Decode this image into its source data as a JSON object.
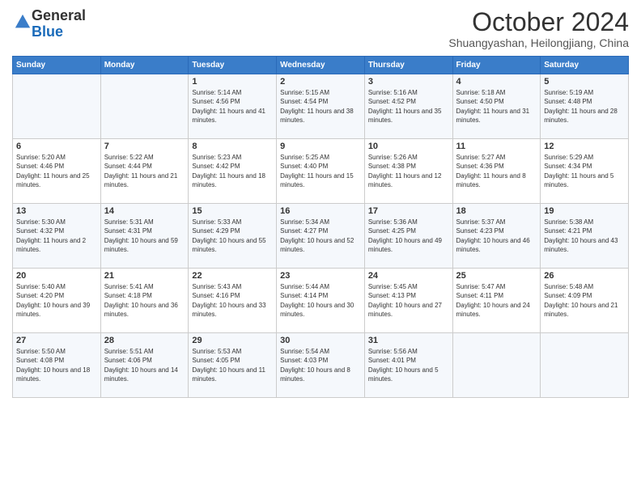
{
  "header": {
    "logo": {
      "line1": "General",
      "line2": "Blue"
    },
    "title": "October 2024",
    "location": "Shuangyashan, Heilongjiang, China"
  },
  "weekdays": [
    "Sunday",
    "Monday",
    "Tuesday",
    "Wednesday",
    "Thursday",
    "Friday",
    "Saturday"
  ],
  "weeks": [
    [
      {
        "day": null,
        "info": null
      },
      {
        "day": null,
        "info": null
      },
      {
        "day": "1",
        "info": "Sunrise: 5:14 AM\nSunset: 4:56 PM\nDaylight: 11 hours and 41 minutes."
      },
      {
        "day": "2",
        "info": "Sunrise: 5:15 AM\nSunset: 4:54 PM\nDaylight: 11 hours and 38 minutes."
      },
      {
        "day": "3",
        "info": "Sunrise: 5:16 AM\nSunset: 4:52 PM\nDaylight: 11 hours and 35 minutes."
      },
      {
        "day": "4",
        "info": "Sunrise: 5:18 AM\nSunset: 4:50 PM\nDaylight: 11 hours and 31 minutes."
      },
      {
        "day": "5",
        "info": "Sunrise: 5:19 AM\nSunset: 4:48 PM\nDaylight: 11 hours and 28 minutes."
      }
    ],
    [
      {
        "day": "6",
        "info": "Sunrise: 5:20 AM\nSunset: 4:46 PM\nDaylight: 11 hours and 25 minutes."
      },
      {
        "day": "7",
        "info": "Sunrise: 5:22 AM\nSunset: 4:44 PM\nDaylight: 11 hours and 21 minutes."
      },
      {
        "day": "8",
        "info": "Sunrise: 5:23 AM\nSunset: 4:42 PM\nDaylight: 11 hours and 18 minutes."
      },
      {
        "day": "9",
        "info": "Sunrise: 5:25 AM\nSunset: 4:40 PM\nDaylight: 11 hours and 15 minutes."
      },
      {
        "day": "10",
        "info": "Sunrise: 5:26 AM\nSunset: 4:38 PM\nDaylight: 11 hours and 12 minutes."
      },
      {
        "day": "11",
        "info": "Sunrise: 5:27 AM\nSunset: 4:36 PM\nDaylight: 11 hours and 8 minutes."
      },
      {
        "day": "12",
        "info": "Sunrise: 5:29 AM\nSunset: 4:34 PM\nDaylight: 11 hours and 5 minutes."
      }
    ],
    [
      {
        "day": "13",
        "info": "Sunrise: 5:30 AM\nSunset: 4:32 PM\nDaylight: 11 hours and 2 minutes."
      },
      {
        "day": "14",
        "info": "Sunrise: 5:31 AM\nSunset: 4:31 PM\nDaylight: 10 hours and 59 minutes."
      },
      {
        "day": "15",
        "info": "Sunrise: 5:33 AM\nSunset: 4:29 PM\nDaylight: 10 hours and 55 minutes."
      },
      {
        "day": "16",
        "info": "Sunrise: 5:34 AM\nSunset: 4:27 PM\nDaylight: 10 hours and 52 minutes."
      },
      {
        "day": "17",
        "info": "Sunrise: 5:36 AM\nSunset: 4:25 PM\nDaylight: 10 hours and 49 minutes."
      },
      {
        "day": "18",
        "info": "Sunrise: 5:37 AM\nSunset: 4:23 PM\nDaylight: 10 hours and 46 minutes."
      },
      {
        "day": "19",
        "info": "Sunrise: 5:38 AM\nSunset: 4:21 PM\nDaylight: 10 hours and 43 minutes."
      }
    ],
    [
      {
        "day": "20",
        "info": "Sunrise: 5:40 AM\nSunset: 4:20 PM\nDaylight: 10 hours and 39 minutes."
      },
      {
        "day": "21",
        "info": "Sunrise: 5:41 AM\nSunset: 4:18 PM\nDaylight: 10 hours and 36 minutes."
      },
      {
        "day": "22",
        "info": "Sunrise: 5:43 AM\nSunset: 4:16 PM\nDaylight: 10 hours and 33 minutes."
      },
      {
        "day": "23",
        "info": "Sunrise: 5:44 AM\nSunset: 4:14 PM\nDaylight: 10 hours and 30 minutes."
      },
      {
        "day": "24",
        "info": "Sunrise: 5:45 AM\nSunset: 4:13 PM\nDaylight: 10 hours and 27 minutes."
      },
      {
        "day": "25",
        "info": "Sunrise: 5:47 AM\nSunset: 4:11 PM\nDaylight: 10 hours and 24 minutes."
      },
      {
        "day": "26",
        "info": "Sunrise: 5:48 AM\nSunset: 4:09 PM\nDaylight: 10 hours and 21 minutes."
      }
    ],
    [
      {
        "day": "27",
        "info": "Sunrise: 5:50 AM\nSunset: 4:08 PM\nDaylight: 10 hours and 18 minutes."
      },
      {
        "day": "28",
        "info": "Sunrise: 5:51 AM\nSunset: 4:06 PM\nDaylight: 10 hours and 14 minutes."
      },
      {
        "day": "29",
        "info": "Sunrise: 5:53 AM\nSunset: 4:05 PM\nDaylight: 10 hours and 11 minutes."
      },
      {
        "day": "30",
        "info": "Sunrise: 5:54 AM\nSunset: 4:03 PM\nDaylight: 10 hours and 8 minutes."
      },
      {
        "day": "31",
        "info": "Sunrise: 5:56 AM\nSunset: 4:01 PM\nDaylight: 10 hours and 5 minutes."
      },
      {
        "day": null,
        "info": null
      },
      {
        "day": null,
        "info": null
      }
    ]
  ]
}
